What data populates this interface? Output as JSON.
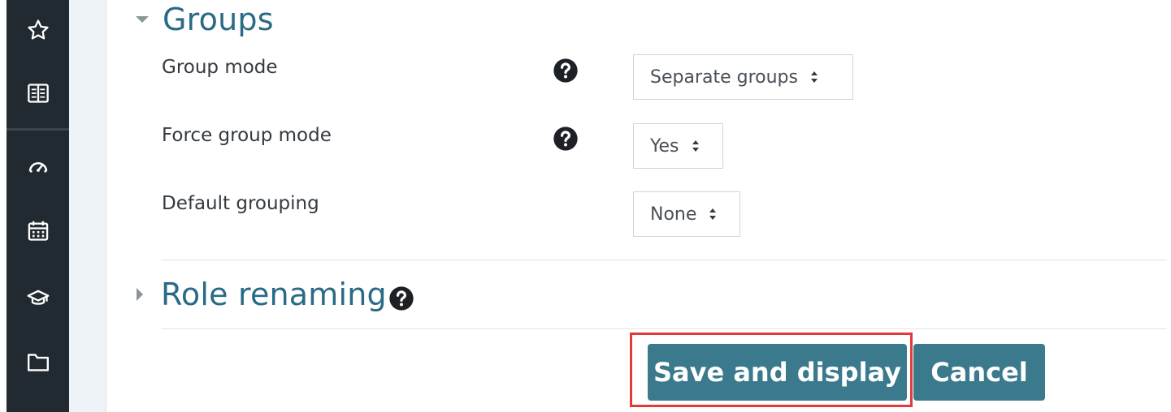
{
  "sidebar": {
    "items": [
      {
        "icon": "star-icon"
      },
      {
        "icon": "book-icon"
      },
      {
        "icon": "dashboard-icon"
      },
      {
        "icon": "calendar-icon"
      },
      {
        "icon": "graduation-cap-icon"
      },
      {
        "icon": "folder-icon"
      }
    ]
  },
  "groups_section": {
    "title": "Groups",
    "fields": [
      {
        "label": "Group mode",
        "value": "Separate groups",
        "has_help": true
      },
      {
        "label": "Force group mode",
        "value": "Yes",
        "has_help": true
      },
      {
        "label": "Default grouping",
        "value": "None",
        "has_help": false
      }
    ]
  },
  "role_section": {
    "title": "Role renaming"
  },
  "buttons": {
    "save_label": "Save and display",
    "cancel_label": "Cancel"
  },
  "colors": {
    "nav_bg": "#212a30",
    "accent": "#2a6a86",
    "button_bg": "#3b7a8c",
    "highlight": "#e23a3a"
  }
}
